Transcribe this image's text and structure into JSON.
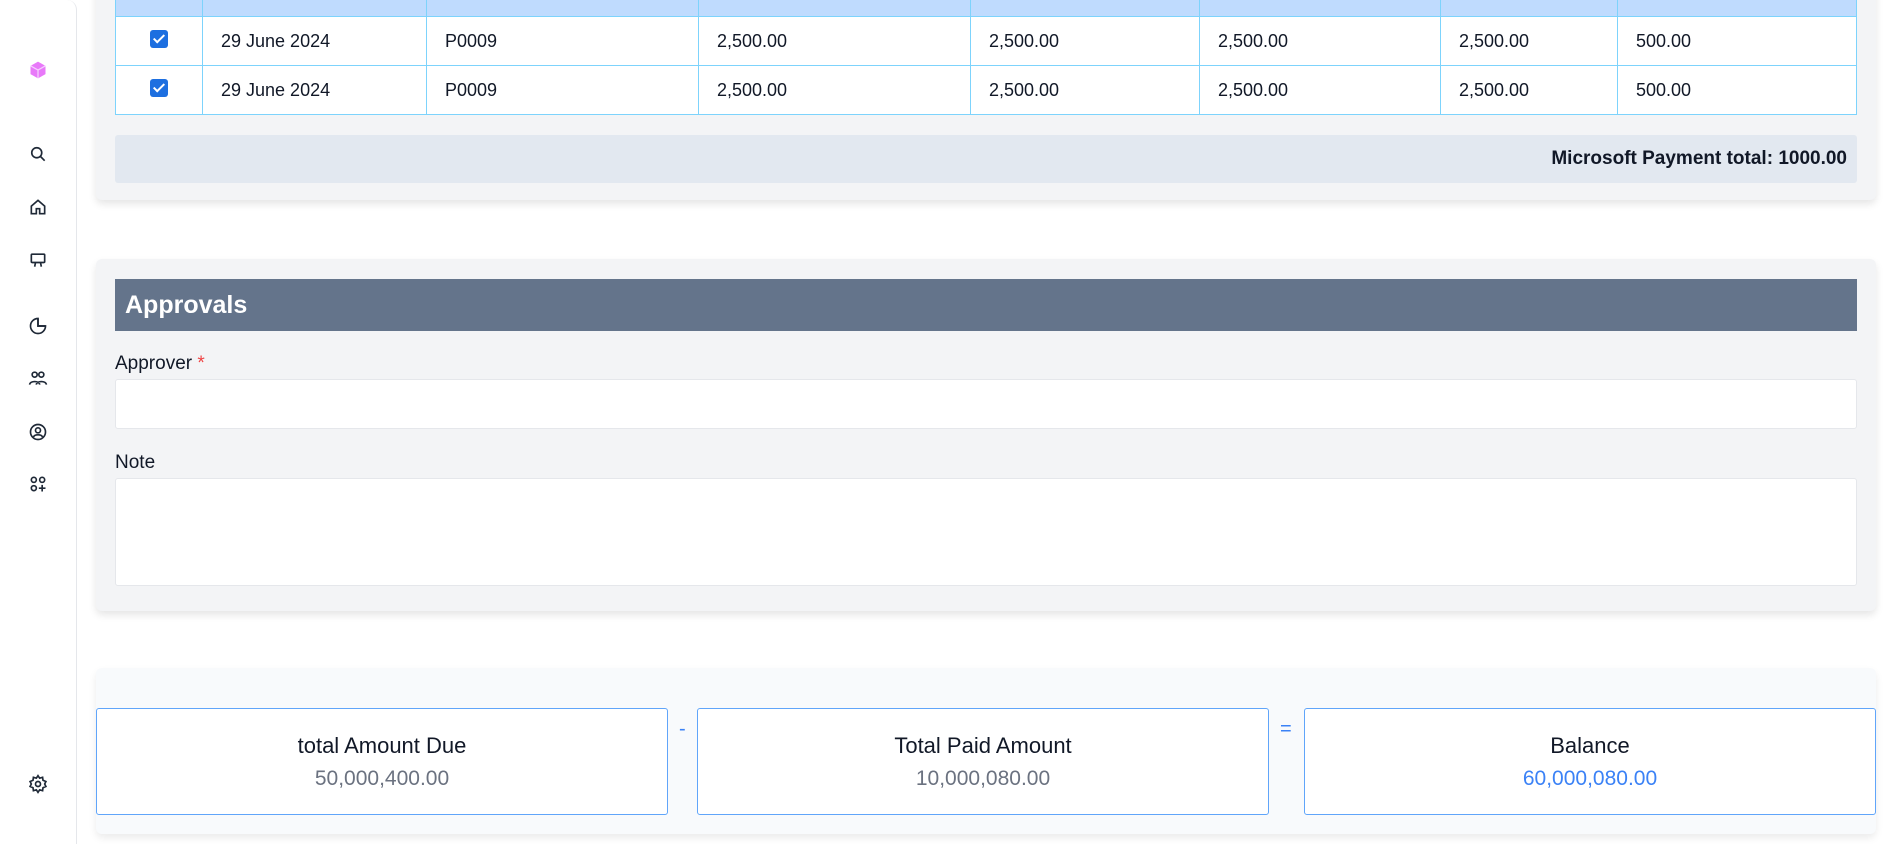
{
  "sidebar": {
    "icons": [
      "logo-cube-icon",
      "search-icon",
      "home-icon",
      "presentation-icon",
      "pie-chart-icon",
      "users-icon",
      "user-circle-icon",
      "apps-icon",
      "gear-icon"
    ]
  },
  "payments_table": {
    "rows": [
      {
        "checked": true,
        "date": "29 June 2024",
        "ref": "P0009",
        "c1": "2,500.00",
        "c2": "2,500.00",
        "c3": "2,500.00",
        "c4": "2,500.00",
        "c5": "500.00"
      },
      {
        "checked": true,
        "date": "29 June 2024",
        "ref": "P0009",
        "c1": "2,500.00",
        "c2": "2,500.00",
        "c3": "2,500.00",
        "c4": "2,500.00",
        "c5": "500.00"
      }
    ],
    "total_label": "Microsoft Payment total: 1000.00"
  },
  "approvals": {
    "title": "Approvals",
    "approver_label": "Approver",
    "required_mark": "*",
    "approver_value": "",
    "note_label": "Note",
    "note_value": ""
  },
  "summary": {
    "due_title": "total Amount Due",
    "due_value": "50,000,400.00",
    "minus": "-",
    "paid_title": "Total Paid Amount",
    "paid_value": "10,000,080.00",
    "equals": "=",
    "balance_title": "Balance",
    "balance_value": "60,000,080.00"
  },
  "colors": {
    "header_bg": "#bfdbfe",
    "approvals_header": "#64748b",
    "accent": "#3b82f6",
    "logo": "#e879f9"
  }
}
